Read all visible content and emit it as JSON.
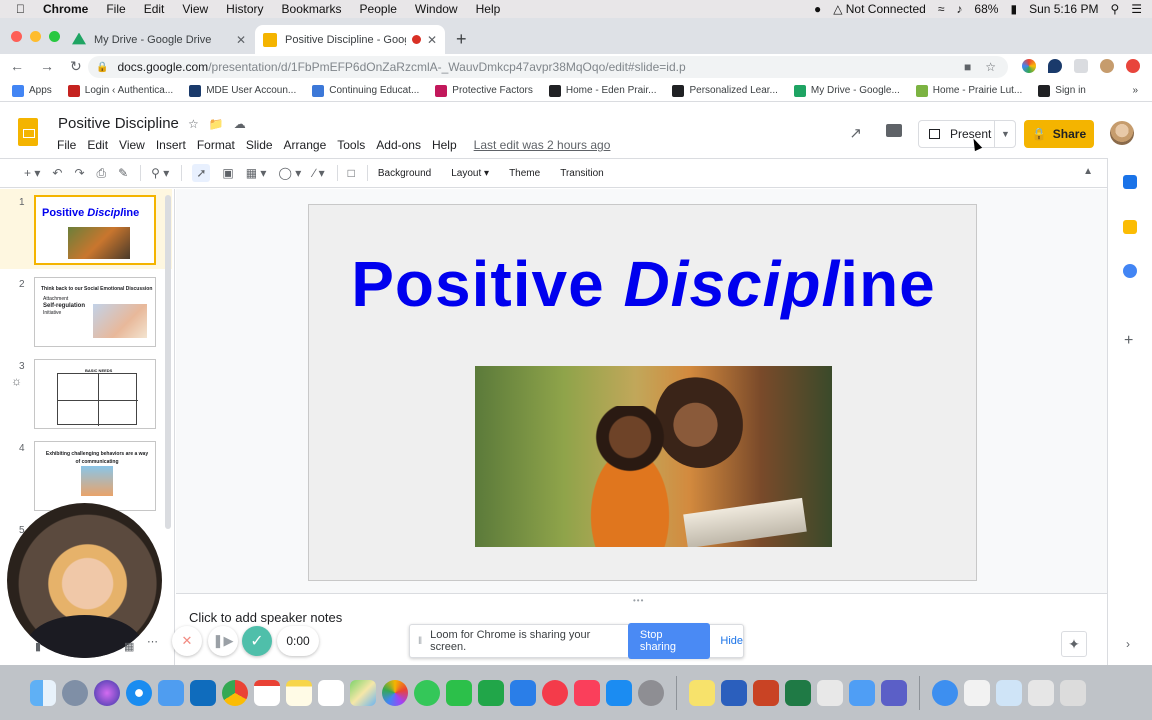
{
  "mac_menubar": {
    "app": "Chrome",
    "items": [
      "File",
      "Edit",
      "View",
      "History",
      "Bookmarks",
      "People",
      "Window",
      "Help"
    ],
    "status": {
      "network": "Not Connected",
      "battery": "68%",
      "datetime": "Sun 5:16 PM"
    }
  },
  "tabs": [
    {
      "title": "My Drive - Google Drive",
      "favicon_color": "#1fa463"
    },
    {
      "title": "Positive Discipline - Google",
      "favicon_color": "#f4b400"
    }
  ],
  "url": {
    "domain": "docs.google.com",
    "path": "/presentation/d/1FbPmEFP6dOnZaRzcmlA-_WauvDmkcp47avpr38MqOqo/edit#slide=id.p"
  },
  "bookmarks": [
    {
      "label": "Apps",
      "color": "#4285f4"
    },
    {
      "label": "Login ‹ Authentica...",
      "color": "#c5221f"
    },
    {
      "label": "MDE User Accoun...",
      "color": "#1a3a6b"
    },
    {
      "label": "Continuing Educat...",
      "color": "#3c78d8"
    },
    {
      "label": "Protective Factors",
      "color": "#c2185b"
    },
    {
      "label": "Home - Eden Prair...",
      "color": "#202124"
    },
    {
      "label": "Personalized Lear...",
      "color": "#202124"
    },
    {
      "label": "My Drive - Google...",
      "color": "#1fa463"
    },
    {
      "label": "Home - Prairie Lut...",
      "color": "#7cb342"
    },
    {
      "label": "Sign in",
      "color": "#202124"
    }
  ],
  "doc": {
    "title": "Positive Discipline",
    "menus": [
      "File",
      "Edit",
      "View",
      "Insert",
      "Format",
      "Slide",
      "Arrange",
      "Tools",
      "Add-ons",
      "Help"
    ],
    "last_edit": "Last edit was 2 hours ago",
    "present_label": "Present",
    "share_label": "Share"
  },
  "toolbar": {
    "background": "Background",
    "layout": "Layout",
    "theme": "Theme",
    "transition": "Transition"
  },
  "filmstrip": {
    "numbers": [
      "1",
      "2",
      "3",
      "4",
      "5"
    ],
    "s1_title_a": "Positive ",
    "s1_title_b": "Discipl",
    "s1_title_c": "ine",
    "s2_title": "Think back to our Social Emotional Discussion",
    "s2_items": [
      "Attachment",
      "Self-regulation",
      "Initiative"
    ],
    "s3_title": "BASIC NEEDS",
    "s4_title": "Exhibiting challenging behaviors are a way of communicating"
  },
  "slide": {
    "title_a": "Positive ",
    "title_b": "Discipl",
    "title_c": "ine"
  },
  "notes": {
    "placeholder": "Click to add speaker notes"
  },
  "loom": {
    "message": "Loom for Chrome is sharing your screen.",
    "stop_label": "Stop sharing",
    "hide_label": "Hide",
    "timer": "0:00"
  },
  "colors": {
    "accent": "#f4b400",
    "title_blue": "#0000ee",
    "loom_blue": "#4a8af4"
  }
}
